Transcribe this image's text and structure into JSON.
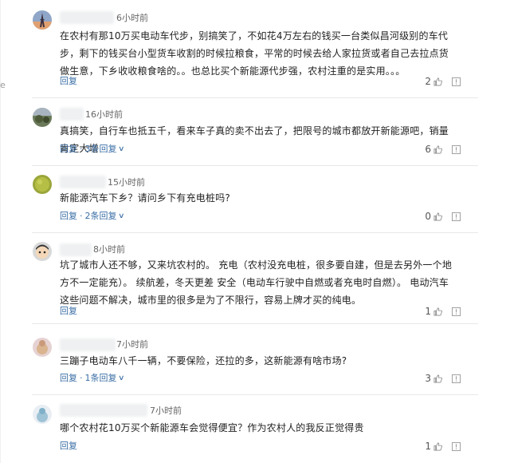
{
  "colors": {
    "link": "#3a6ea5",
    "text": "#222222",
    "meta": "#666666",
    "divider": "#e8e8e8"
  },
  "side_mark": "e",
  "comments": [
    {
      "avatar": "avatar-eiffel-tower",
      "time": "6小时前",
      "text": "在农村有那10万买电动车代步，别搞笑了，不如花4万左右的钱买一台类似昌河级别的车代步，剩下的钱买台小型货车收割的时候拉粮食，平常的时候去给人家拉货或者自己去拉点货做生意，下乡收收粮食啥的。。也总比买个新能源代步强，农村注重的是实用。。。",
      "reply": "回复",
      "more": "",
      "likes": "2"
    },
    {
      "avatar": "avatar-outdoor-photo",
      "time": "16小时前",
      "text": "真搞笑，自行车也抵五千，看来车子真的卖不出去了，把限号的城市都放开新能源吧，销量肯定大增",
      "reply": "回复",
      "more": "3条回复",
      "likes": "6"
    },
    {
      "avatar": "avatar-green-field",
      "time": "15小时前",
      "text": "新能源汽车下乡？请问乡下有充电桩吗?",
      "reply": "回复",
      "more": "2条回复",
      "likes": "0"
    },
    {
      "avatar": "avatar-cartoon-face",
      "time": "8小时前",
      "text": "坑了城市人还不够，又来坑农村的。 充电（农村没充电桩，很多要自建，但是去另外一个地方不一定能充）。 续航差，冬天更差 安全（电动车行驶中自燃或者充电时自燃）。 电动汽车这些问题不解决，城市里的很多是为了不限行，容易上牌才买的纯电。",
      "reply": "回复",
      "more": "",
      "likes": "1"
    },
    {
      "avatar": "avatar-pink-character",
      "time": "7小时前",
      "text": "三蹦子电动车八千一辆，不要保险，还拉的多，这新能源有啥市场?",
      "reply": "回复",
      "more": "1条回复",
      "likes": "3"
    },
    {
      "avatar": "avatar-blue-character",
      "time": "7小时前",
      "text": "哪个农村花10万买个新能源车会觉得便宜？作为农村人的我反正觉得贵",
      "reply": "回复",
      "more": "",
      "likes": "1"
    }
  ]
}
